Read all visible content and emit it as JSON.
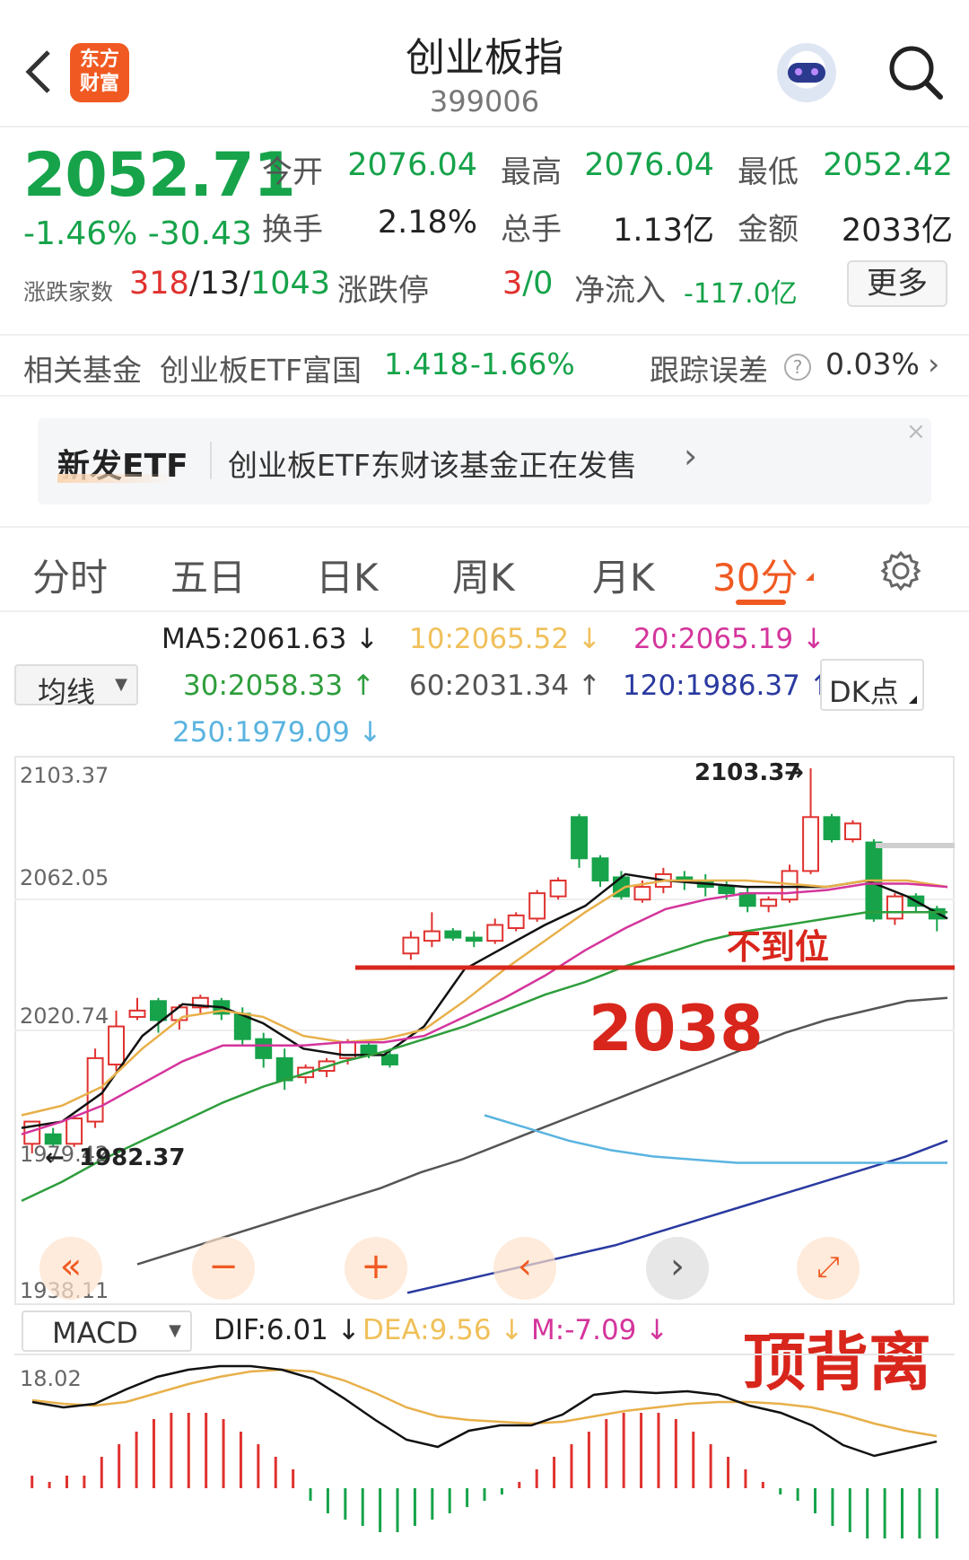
{
  "header": {
    "logo_text": "东方\n财富",
    "title": "创业板指",
    "code": "399006"
  },
  "quote": {
    "price": "2052.71",
    "change": "-1.46% -30.43",
    "open_label": "今开",
    "open": "2076.04",
    "high_label": "最高",
    "high": "2076.04",
    "low_label": "最低",
    "low": "2052.42",
    "turnover_label": "换手",
    "turnover": "2.18%",
    "volume_label": "总手",
    "volume": "1.13亿",
    "amount_label": "金额",
    "amount": "2033亿",
    "breadth_label": "涨跌家数",
    "breadth_up": "318",
    "breadth_flat": "/13/",
    "breadth_down": "1043",
    "limit_label": "涨跌停",
    "limit_up": "3",
    "limit_down": "/0",
    "netflow_label": "净流入",
    "netflow": "-117.0亿",
    "more": "更多"
  },
  "fund": {
    "label": "相关基金",
    "name": "创业板ETF富国",
    "price": "1.418",
    "change": "-1.66%",
    "tracking_label": "跟踪误差",
    "tracking": "0.03%"
  },
  "banner": {
    "tag": "新发ETF",
    "text": "创业板ETF东财该基金正在发售"
  },
  "tabs": [
    "分时",
    "五日",
    "日K",
    "周K",
    "月K",
    "30分"
  ],
  "ma": {
    "selector": "均线",
    "ma5": "MA5:2061.63",
    "ma10": "10:2065.52",
    "ma20": "20:2065.19",
    "ma30": "30:2058.33",
    "ma60": "60:2031.34",
    "ma120": "120:1986.37",
    "ma250": "250:1979.09",
    "dk": "DK点"
  },
  "macd": {
    "selector": "MACD",
    "dif": "DIF:6.01",
    "dea": "DEA:9.56",
    "m": "M:-7.09",
    "top": "18.02"
  },
  "chart_data": {
    "type": "candlestick",
    "y_ticks": [
      "2103.37",
      "2062.05",
      "2020.74",
      "1979.42",
      "1938.11"
    ],
    "ylim": [
      1938.11,
      2103.37
    ],
    "high_marker": "2103.37",
    "low_marker": "1982.37",
    "candles": [
      [
        1985,
        1992,
        1982,
        1988
      ],
      [
        1988,
        1985,
        1984,
        1990
      ],
      [
        1985,
        1993,
        1984,
        1994
      ],
      [
        1992,
        2012,
        1990,
        2015
      ],
      [
        2010,
        2022,
        2008,
        2027
      ],
      [
        2025,
        2027,
        2024,
        2031
      ],
      [
        2030,
        2024,
        2020,
        2031
      ],
      [
        2024,
        2028,
        2021,
        2029
      ],
      [
        2028,
        2031,
        2026,
        2032
      ],
      [
        2030,
        2026,
        2024,
        2031
      ],
      [
        2026,
        2018,
        2016,
        2028
      ],
      [
        2018,
        2012,
        2009,
        2020
      ],
      [
        2012,
        2005,
        2002,
        2015
      ],
      [
        2006,
        2009,
        2004,
        2010
      ],
      [
        2008,
        2011,
        2006,
        2012
      ],
      [
        2012,
        2017,
        2010,
        2018
      ],
      [
        2016,
        2013,
        2012,
        2017
      ],
      [
        2013,
        2010,
        2009,
        2015
      ],
      [
        2045,
        2050,
        2043,
        2052
      ],
      [
        2049,
        2052,
        2047,
        2058
      ],
      [
        2052,
        2050,
        2049,
        2053
      ],
      [
        2050,
        2049,
        2047,
        2052
      ],
      [
        2049,
        2054,
        2048,
        2056
      ],
      [
        2053,
        2057,
        2052,
        2058
      ],
      [
        2056,
        2064,
        2055,
        2065
      ],
      [
        2063,
        2068,
        2062,
        2069
      ],
      [
        2088,
        2075,
        2072,
        2089
      ],
      [
        2075,
        2068,
        2066,
        2076
      ],
      [
        2069,
        2063,
        2062,
        2071
      ],
      [
        2062,
        2066,
        2061,
        2068
      ],
      [
        2066,
        2070,
        2064,
        2072
      ],
      [
        2069,
        2068,
        2065,
        2071
      ],
      [
        2068,
        2066,
        2063,
        2070
      ],
      [
        2066,
        2064,
        2062,
        2068
      ],
      [
        2064,
        2060,
        2058,
        2066
      ],
      [
        2060,
        2062,
        2058,
        2063
      ],
      [
        2062,
        2071,
        2061,
        2073
      ],
      [
        2071,
        2088,
        2070,
        2103.37
      ],
      [
        2088,
        2081,
        2080,
        2089
      ],
      [
        2081,
        2086,
        2080,
        2087
      ],
      [
        2080,
        2056,
        2055,
        2081
      ],
      [
        2056,
        2063,
        2054,
        2064
      ],
      [
        2063,
        2060,
        2058,
        2064
      ],
      [
        2059,
        2056,
        2052,
        2060
      ]
    ],
    "series": [
      {
        "name": "MA5",
        "color": "#111111",
        "values": [
          1990,
          1992,
          2001,
          2019,
          2029,
          2028,
          2023,
          2015,
          2013,
          2013,
          2022,
          2040,
          2047,
          2054,
          2060,
          2070,
          2068,
          2067,
          2066,
          2066,
          2066,
          2068,
          2063,
          2056
        ]
      },
      {
        "name": "MA10",
        "color": "#e8b04a",
        "values": [
          1994,
          1997,
          2003,
          2015,
          2025,
          2027,
          2025,
          2019,
          2017,
          2018,
          2021,
          2030,
          2040,
          2049,
          2058,
          2066,
          2068,
          2068,
          2068,
          2067,
          2066,
          2068,
          2068,
          2066
        ]
      },
      {
        "name": "MA20",
        "color": "#d4359c",
        "values": [
          1988,
          1992,
          1997,
          2004,
          2011,
          2016,
          2016,
          2016,
          2017,
          2017,
          2019,
          2025,
          2031,
          2038,
          2046,
          2053,
          2059,
          2062,
          2064,
          2064,
          2065,
          2067,
          2067,
          2066
        ]
      },
      {
        "name": "MA30",
        "color": "#2e9e3c",
        "values": [
          1967,
          1973,
          1980,
          1986,
          1992,
          1998,
          2003,
          2007,
          2011,
          2014,
          2018,
          2022,
          2027,
          2032,
          2036,
          2041,
          2045,
          2049,
          2052,
          2054,
          2056,
          2058,
          2058,
          2058
        ]
      },
      {
        "name": "MA60",
        "color": "#555555",
        "values": [
          1947,
          1951,
          1955,
          1959,
          1963,
          1967,
          1971,
          1976,
          1980,
          1985,
          1990,
          1995,
          2000,
          2005,
          2010,
          2015,
          2020,
          2024,
          2027,
          2030,
          2031
        ]
      },
      {
        "name": "MA120",
        "color": "#2a3aa0",
        "values": [
          1938,
          1941,
          1944,
          1947,
          1950,
          1953,
          1957,
          1961,
          1965,
          1969,
          1973,
          1977,
          1981,
          1986
        ]
      },
      {
        "name": "MA250",
        "color": "#5ab4e0",
        "values": [
          1994,
          1990,
          1986,
          1983,
          1981,
          1980,
          1979,
          1979,
          1979,
          1979,
          1979,
          1979
        ]
      }
    ],
    "annotation_line": "2038",
    "annotation_text": "不到位",
    "macd_label": "顶背离",
    "macd_bars": [
      2,
      1,
      2,
      2,
      5,
      7,
      9,
      11,
      12,
      12,
      12,
      11,
      9,
      7,
      5,
      3,
      -2,
      -4,
      -5,
      -6,
      -7,
      -7,
      -6,
      -5,
      -4,
      -3,
      -2,
      -1,
      1,
      3,
      5,
      7,
      9,
      11,
      12,
      12,
      12,
      11,
      9,
      7,
      5,
      3,
      1,
      -1,
      -2,
      -4,
      -6,
      -7,
      -8,
      -8,
      -8,
      -8,
      -8
    ]
  }
}
